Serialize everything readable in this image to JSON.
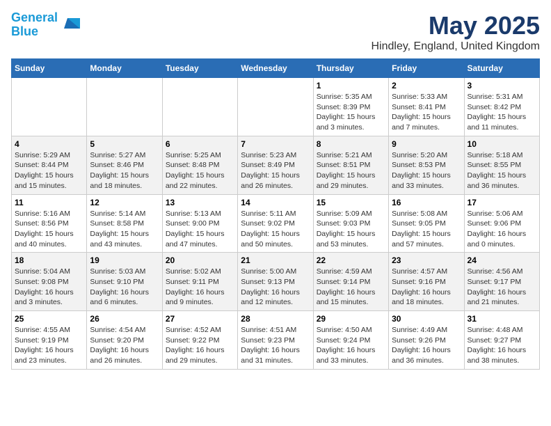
{
  "header": {
    "logo_line1": "General",
    "logo_line2": "Blue",
    "month": "May 2025",
    "location": "Hindley, England, United Kingdom"
  },
  "weekdays": [
    "Sunday",
    "Monday",
    "Tuesday",
    "Wednesday",
    "Thursday",
    "Friday",
    "Saturday"
  ],
  "weeks": [
    [
      {
        "day": "",
        "info": ""
      },
      {
        "day": "",
        "info": ""
      },
      {
        "day": "",
        "info": ""
      },
      {
        "day": "",
        "info": ""
      },
      {
        "day": "1",
        "info": "Sunrise: 5:35 AM\nSunset: 8:39 PM\nDaylight: 15 hours\nand 3 minutes."
      },
      {
        "day": "2",
        "info": "Sunrise: 5:33 AM\nSunset: 8:41 PM\nDaylight: 15 hours\nand 7 minutes."
      },
      {
        "day": "3",
        "info": "Sunrise: 5:31 AM\nSunset: 8:42 PM\nDaylight: 15 hours\nand 11 minutes."
      }
    ],
    [
      {
        "day": "4",
        "info": "Sunrise: 5:29 AM\nSunset: 8:44 PM\nDaylight: 15 hours\nand 15 minutes."
      },
      {
        "day": "5",
        "info": "Sunrise: 5:27 AM\nSunset: 8:46 PM\nDaylight: 15 hours\nand 18 minutes."
      },
      {
        "day": "6",
        "info": "Sunrise: 5:25 AM\nSunset: 8:48 PM\nDaylight: 15 hours\nand 22 minutes."
      },
      {
        "day": "7",
        "info": "Sunrise: 5:23 AM\nSunset: 8:49 PM\nDaylight: 15 hours\nand 26 minutes."
      },
      {
        "day": "8",
        "info": "Sunrise: 5:21 AM\nSunset: 8:51 PM\nDaylight: 15 hours\nand 29 minutes."
      },
      {
        "day": "9",
        "info": "Sunrise: 5:20 AM\nSunset: 8:53 PM\nDaylight: 15 hours\nand 33 minutes."
      },
      {
        "day": "10",
        "info": "Sunrise: 5:18 AM\nSunset: 8:55 PM\nDaylight: 15 hours\nand 36 minutes."
      }
    ],
    [
      {
        "day": "11",
        "info": "Sunrise: 5:16 AM\nSunset: 8:56 PM\nDaylight: 15 hours\nand 40 minutes."
      },
      {
        "day": "12",
        "info": "Sunrise: 5:14 AM\nSunset: 8:58 PM\nDaylight: 15 hours\nand 43 minutes."
      },
      {
        "day": "13",
        "info": "Sunrise: 5:13 AM\nSunset: 9:00 PM\nDaylight: 15 hours\nand 47 minutes."
      },
      {
        "day": "14",
        "info": "Sunrise: 5:11 AM\nSunset: 9:02 PM\nDaylight: 15 hours\nand 50 minutes."
      },
      {
        "day": "15",
        "info": "Sunrise: 5:09 AM\nSunset: 9:03 PM\nDaylight: 15 hours\nand 53 minutes."
      },
      {
        "day": "16",
        "info": "Sunrise: 5:08 AM\nSunset: 9:05 PM\nDaylight: 15 hours\nand 57 minutes."
      },
      {
        "day": "17",
        "info": "Sunrise: 5:06 AM\nSunset: 9:06 PM\nDaylight: 16 hours\nand 0 minutes."
      }
    ],
    [
      {
        "day": "18",
        "info": "Sunrise: 5:04 AM\nSunset: 9:08 PM\nDaylight: 16 hours\nand 3 minutes."
      },
      {
        "day": "19",
        "info": "Sunrise: 5:03 AM\nSunset: 9:10 PM\nDaylight: 16 hours\nand 6 minutes."
      },
      {
        "day": "20",
        "info": "Sunrise: 5:02 AM\nSunset: 9:11 PM\nDaylight: 16 hours\nand 9 minutes."
      },
      {
        "day": "21",
        "info": "Sunrise: 5:00 AM\nSunset: 9:13 PM\nDaylight: 16 hours\nand 12 minutes."
      },
      {
        "day": "22",
        "info": "Sunrise: 4:59 AM\nSunset: 9:14 PM\nDaylight: 16 hours\nand 15 minutes."
      },
      {
        "day": "23",
        "info": "Sunrise: 4:57 AM\nSunset: 9:16 PM\nDaylight: 16 hours\nand 18 minutes."
      },
      {
        "day": "24",
        "info": "Sunrise: 4:56 AM\nSunset: 9:17 PM\nDaylight: 16 hours\nand 21 minutes."
      }
    ],
    [
      {
        "day": "25",
        "info": "Sunrise: 4:55 AM\nSunset: 9:19 PM\nDaylight: 16 hours\nand 23 minutes."
      },
      {
        "day": "26",
        "info": "Sunrise: 4:54 AM\nSunset: 9:20 PM\nDaylight: 16 hours\nand 26 minutes."
      },
      {
        "day": "27",
        "info": "Sunrise: 4:52 AM\nSunset: 9:22 PM\nDaylight: 16 hours\nand 29 minutes."
      },
      {
        "day": "28",
        "info": "Sunrise: 4:51 AM\nSunset: 9:23 PM\nDaylight: 16 hours\nand 31 minutes."
      },
      {
        "day": "29",
        "info": "Sunrise: 4:50 AM\nSunset: 9:24 PM\nDaylight: 16 hours\nand 33 minutes."
      },
      {
        "day": "30",
        "info": "Sunrise: 4:49 AM\nSunset: 9:26 PM\nDaylight: 16 hours\nand 36 minutes."
      },
      {
        "day": "31",
        "info": "Sunrise: 4:48 AM\nSunset: 9:27 PM\nDaylight: 16 hours\nand 38 minutes."
      }
    ]
  ]
}
